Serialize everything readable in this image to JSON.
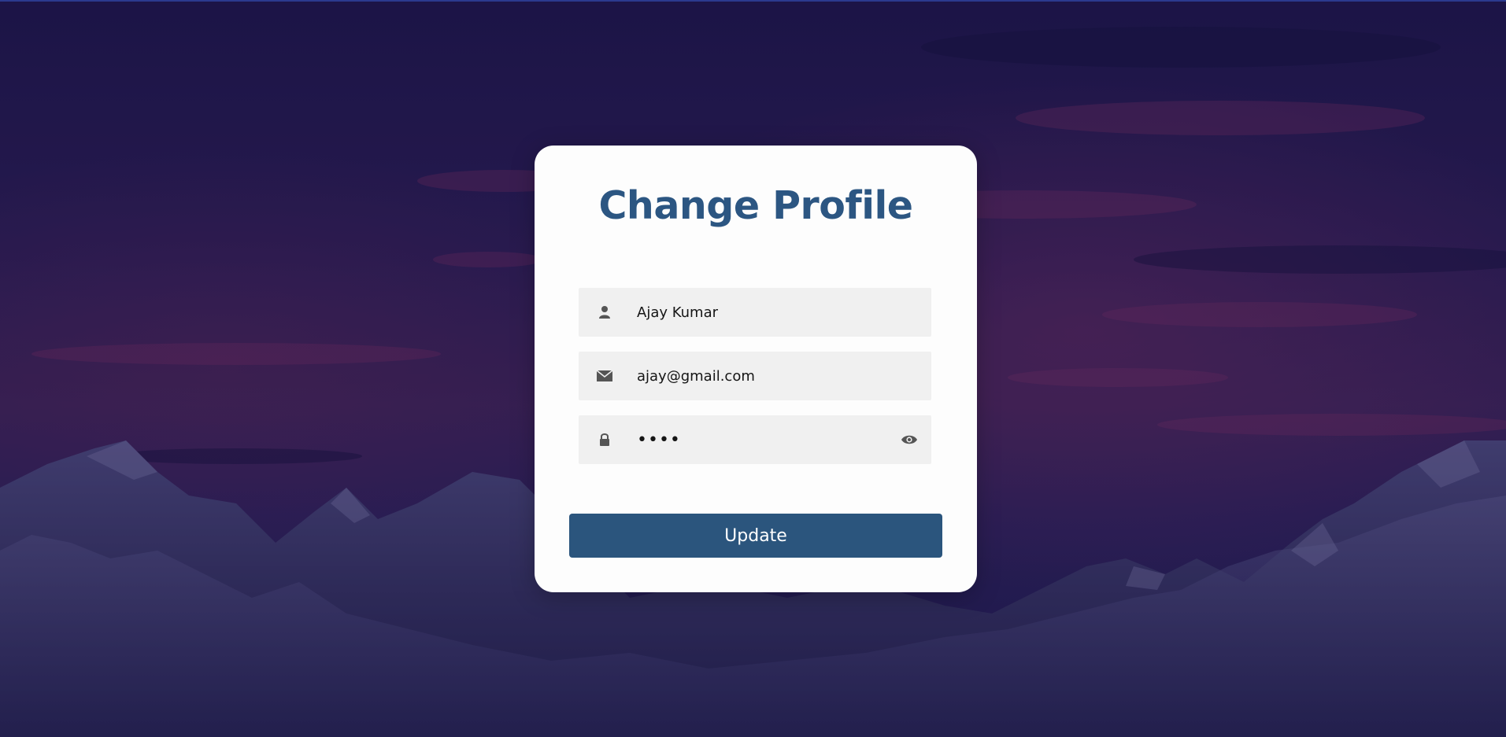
{
  "page": {
    "title": "Change Profile"
  },
  "form": {
    "name": {
      "value": "Ajay Kumar",
      "icon": "user-icon"
    },
    "email": {
      "value": "ajay@gmail.com",
      "icon": "envelope-icon"
    },
    "password": {
      "value": "abcd",
      "icon": "lock-icon",
      "toggle_icon": "eye-icon"
    },
    "submit_label": "Update"
  },
  "colors": {
    "title": "#2c5682",
    "button": "#2b557d",
    "field_bg": "#f0f0f0",
    "card_bg": "#fdfdfd"
  }
}
